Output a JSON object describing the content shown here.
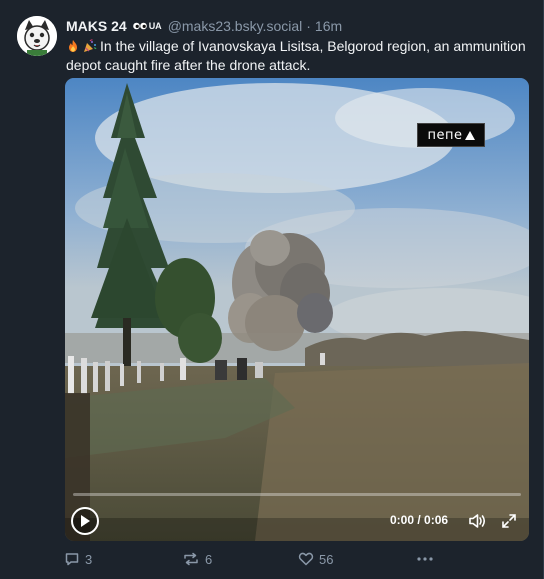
{
  "post": {
    "author": {
      "display_name": "MAKS 24",
      "badge_label": "UA",
      "handle": "@maks23.bsky.social",
      "separator": "·",
      "time": "16m"
    },
    "text": "In the village of Ivanovskaya Lisitsa, Belgorod region, an ammunition depot caught fire after the drone attack.",
    "text_emojis": [
      "fire-icon",
      "party-popper-icon"
    ],
    "video": {
      "watermark": "пепе",
      "timecode": "0:00 / 0:06",
      "progress": 0
    },
    "stats": {
      "replies": "3",
      "reposts": "6",
      "likes": "56"
    }
  },
  "colors": {
    "background": "#1c232c",
    "secondary_text": "#8a98a8",
    "primary_text": "#f1f3f5"
  }
}
